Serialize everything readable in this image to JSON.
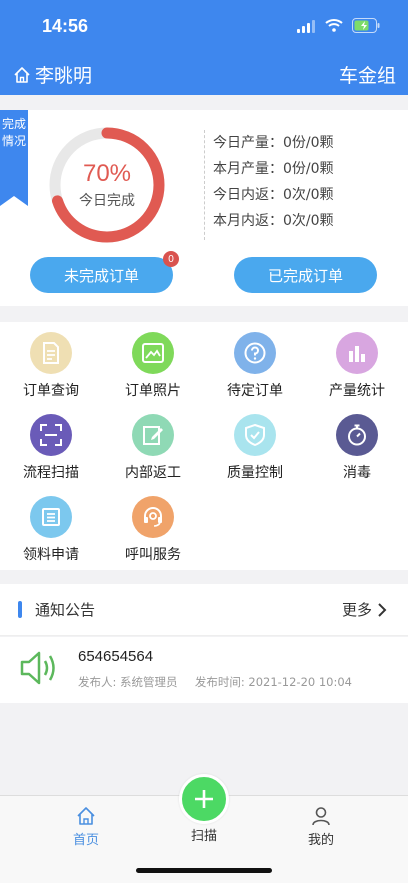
{
  "status_bar": {
    "time": "14:56"
  },
  "header": {
    "user_name": "李晀明",
    "group_name": "车金组"
  },
  "summary": {
    "ribbon_label": "完成情况",
    "completion_percent_text": "70%",
    "completion_fraction": 0.7,
    "completion_label": "今日完成",
    "stats": [
      {
        "label": "今日产量：",
        "value": "0份/0颗"
      },
      {
        "label": "本月产量：",
        "value": "0份/0颗"
      },
      {
        "label": "今日内返：",
        "value": "0次/0颗"
      },
      {
        "label": "本月内返：",
        "value": "0次/0颗"
      }
    ],
    "incomplete_button": "未完成订单",
    "incomplete_badge": "0",
    "complete_button": "已完成订单",
    "ring_color": "#e05a52"
  },
  "menu": {
    "items": [
      {
        "label": "订单查询",
        "icon": "document-icon",
        "color": "#efdfb3"
      },
      {
        "label": "订单照片",
        "icon": "photo-icon",
        "color": "#7fd95a"
      },
      {
        "label": "待定订单",
        "icon": "question-icon",
        "color": "#7fb2ea"
      },
      {
        "label": "产量统计",
        "icon": "bar-chart-icon",
        "color": "#d8a6e0"
      },
      {
        "label": "流程扫描",
        "icon": "scan-icon",
        "color": "#6a5bb8"
      },
      {
        "label": "内部返工",
        "icon": "edit-icon",
        "color": "#8fd9b5"
      },
      {
        "label": "质量控制",
        "icon": "shield-check-icon",
        "color": "#a9e4ee"
      },
      {
        "label": "消毒",
        "icon": "stopwatch-icon",
        "color": "#5a5a93"
      },
      {
        "label": "领料申请",
        "icon": "form-icon",
        "color": "#7cc8ee"
      },
      {
        "label": "呼叫服务",
        "icon": "headset-icon",
        "color": "#f0a36a"
      }
    ]
  },
  "notice": {
    "title": "通知公告",
    "more": "更多",
    "items": [
      {
        "message": "654654564",
        "publisher": "发布人: 系统管理员",
        "time": "发布时间: 2021-12-20 10:04"
      }
    ]
  },
  "tabbar": {
    "home": "首页",
    "scan": "扫描",
    "mine": "我的",
    "active_color": "#4a8fe0"
  }
}
